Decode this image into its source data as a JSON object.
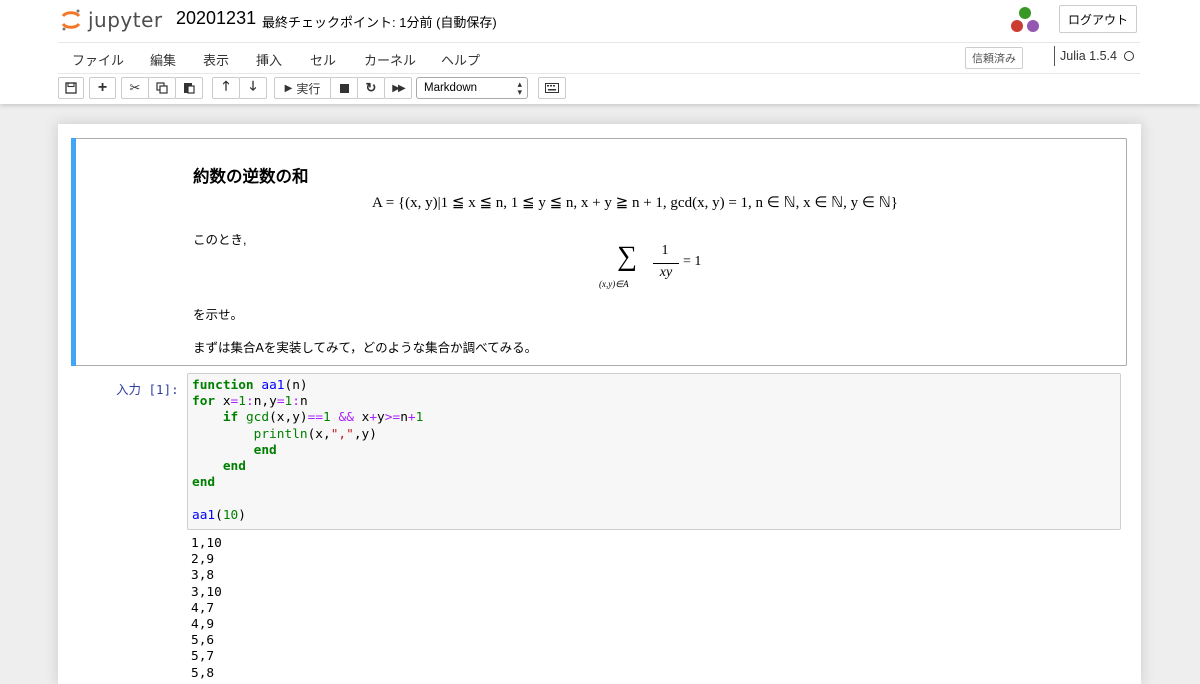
{
  "header": {
    "logo_text": "jupyter",
    "notebook_name": "20201231",
    "checkpoint": "最終チェックポイント: 1分前 (自動保存)",
    "logout_label": "ログアウト"
  },
  "menubar": {
    "items": [
      "ファイル",
      "編集",
      "表示",
      "挿入",
      "セル",
      "カーネル",
      "ヘルプ"
    ],
    "trusted_label": "信頼済み",
    "kernel_name": "Julia 1.5.4"
  },
  "toolbar": {
    "run_label": "実行",
    "cell_type": "Markdown"
  },
  "markdown_cell": {
    "heading": "約数の逆数の和",
    "set_definition": "A = {(x, y)|1 ≦ x ≦ n, 1 ≦ y ≦ n, x + y ≧ n + 1, gcd(x, y) = 1, n ∈ ℕ, x ∈ ℕ, y ∈ ℕ}",
    "paragraph1": "このとき,",
    "sum_symbol": "∑",
    "sum_subscript": "(x,y)∈A",
    "fraction_numerator": "1",
    "fraction_denominator": "xy",
    "equation_rhs": "= 1",
    "paragraph2": "を示せ。",
    "paragraph3": "まずは集合Aを実装してみて，どのような集合か調べてみる。"
  },
  "code_cell": {
    "prompt": "入力 [1]:",
    "source": [
      "function aa1(n)",
      "for x=1:n,y=1:n",
      "    if gcd(x,y)==1 && x+y>=n+1",
      "        println(x,\",\",y)",
      "        end",
      "    end",
      "end",
      "",
      "aa1(10)"
    ],
    "output": [
      "1,10",
      "2,9",
      "3,8",
      "3,10",
      "4,7",
      "4,9",
      "5,6",
      "5,7",
      "5,8"
    ]
  },
  "colors": {
    "selected_cell_bar": "#42a5f5",
    "prompt_color": "#303f9f",
    "keyword_color": "#008000",
    "function_name_color": "#0000ff",
    "operator_color": "#aa22ff",
    "string_color": "#ba2121"
  }
}
